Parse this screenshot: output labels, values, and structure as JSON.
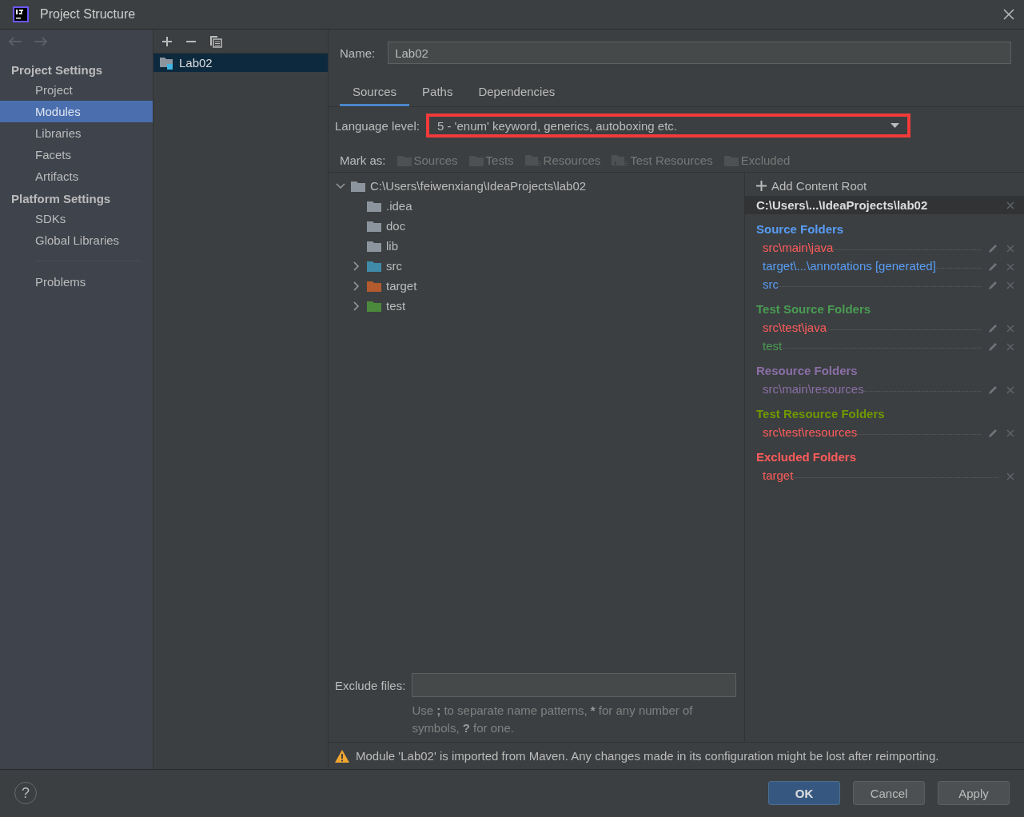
{
  "window": {
    "title": "Project Structure"
  },
  "sidebar": {
    "sections": [
      {
        "heading": "Project Settings",
        "items": [
          {
            "label": "Project",
            "selected": false
          },
          {
            "label": "Modules",
            "selected": true
          },
          {
            "label": "Libraries",
            "selected": false
          },
          {
            "label": "Facets",
            "selected": false
          },
          {
            "label": "Artifacts",
            "selected": false
          }
        ]
      },
      {
        "heading": "Platform Settings",
        "items": [
          {
            "label": "SDKs",
            "selected": false
          },
          {
            "label": "Global Libraries",
            "selected": false
          }
        ]
      }
    ],
    "bottom_items": [
      {
        "label": "Problems",
        "selected": false
      }
    ]
  },
  "modules": [
    {
      "label": "Lab02",
      "selected": true
    }
  ],
  "name_field": {
    "label": "Name:",
    "value": "Lab02"
  },
  "tabs": [
    {
      "label": "Sources",
      "selected": true
    },
    {
      "label": "Paths",
      "selected": false
    },
    {
      "label": "Dependencies",
      "selected": false
    }
  ],
  "language_level": {
    "label": "Language level:",
    "value": "5 - 'enum' keyword, generics, autoboxing etc.",
    "highlighted": true
  },
  "mark_as": {
    "label": "Mark as:",
    "buttons": [
      {
        "label": "Sources",
        "kind": "folder",
        "disabled": true
      },
      {
        "label": "Tests",
        "kind": "folder",
        "disabled": true
      },
      {
        "label": "Resources",
        "kind": "resources",
        "disabled": true
      },
      {
        "label": "Test Resources",
        "kind": "test-resources",
        "disabled": true
      },
      {
        "label": "Excluded",
        "kind": "folder",
        "disabled": true
      }
    ]
  },
  "tree": {
    "label": "C:\\Users\\feiwenxiang\\IdeaProjects\\lab02",
    "expanded": true,
    "children": [
      {
        "label": ".idea",
        "kind": "plain",
        "expandable": false,
        "expanded": false
      },
      {
        "label": "doc",
        "kind": "plain",
        "expandable": false,
        "expanded": false
      },
      {
        "label": "lib",
        "kind": "plain",
        "expandable": false,
        "expanded": false
      },
      {
        "label": "src",
        "kind": "source",
        "expandable": true,
        "expanded": false
      },
      {
        "label": "target",
        "kind": "excluded",
        "expandable": true,
        "expanded": false
      },
      {
        "label": "test",
        "kind": "test",
        "expandable": true,
        "expanded": false
      }
    ]
  },
  "exclude_files": {
    "label": "Exclude files:",
    "hint": [
      {
        "text": "Use ",
        "bold": false
      },
      {
        "text": ";",
        "bold": true
      },
      {
        "text": " to separate name patterns, ",
        "bold": false
      },
      {
        "text": "*",
        "bold": true
      },
      {
        "text": " for any number of symbols, ",
        "bold": false
      },
      {
        "text": "?",
        "bold": true
      },
      {
        "text": " for one.",
        "bold": false
      }
    ]
  },
  "content_root": {
    "add_label": "Add Content Root",
    "path": "C:\\Users\\...\\IdeaProjects\\lab02",
    "groups": [
      {
        "title": "Source Folders",
        "color": "#589df6",
        "folders": [
          {
            "path": "src\\main\\java",
            "color": "#ff5c5c",
            "editable": true
          },
          {
            "path": "target\\...\\annotations [generated]",
            "color": "#589df6",
            "editable": true
          },
          {
            "path": "src",
            "color": "#589df6",
            "editable": true
          }
        ]
      },
      {
        "title": "Test Source Folders",
        "color": "#499c54",
        "folders": [
          {
            "path": "src\\test\\java",
            "color": "#ff5c5c",
            "editable": true
          },
          {
            "path": "test",
            "color": "#499c54",
            "editable": true
          }
        ]
      },
      {
        "title": "Resource Folders",
        "color": "#8a6fa8",
        "folders": [
          {
            "path": "src\\main\\resources",
            "color": "#8a6fa8",
            "editable": true
          }
        ]
      },
      {
        "title": "Test Resource Folders",
        "color": "#6f9a00",
        "folders": [
          {
            "path": "src\\test\\resources",
            "color": "#ff5c5c",
            "editable": true
          }
        ]
      },
      {
        "title": "Excluded Folders",
        "color": "#ff5c5c",
        "folders": [
          {
            "path": "target",
            "color": "#ff5c5c",
            "editable": false
          }
        ]
      }
    ]
  },
  "warning": "Module 'Lab02' is imported from Maven. Any changes made in its configuration might be lost after reimporting.",
  "footer": {
    "help": "?",
    "buttons": [
      {
        "label": "OK",
        "kind": "default"
      },
      {
        "label": "Cancel",
        "kind": "normal"
      },
      {
        "label": "Apply",
        "kind": "normal"
      }
    ]
  }
}
